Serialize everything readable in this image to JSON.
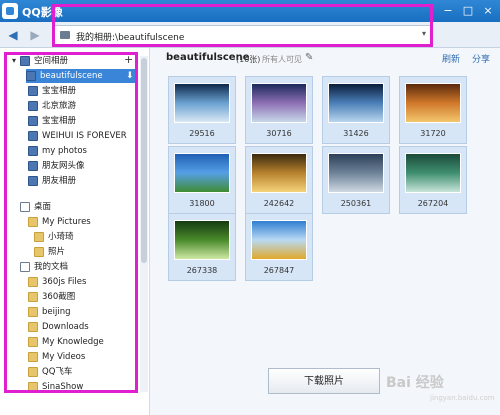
{
  "window": {
    "title": "QQ影像",
    "controls": [
      "−",
      "□",
      "×"
    ]
  },
  "toolbar": {
    "back": "◀",
    "forward": "▶",
    "address": "我的相册:\\beautifulscene",
    "address_dropdown": "▾"
  },
  "sidebar": {
    "items": [
      {
        "label": "空间相册",
        "icon": "album-icon",
        "type": "header"
      },
      {
        "label": "beautifulscene",
        "icon": "album-icon",
        "selected": true
      },
      {
        "label": "宝宝相册",
        "icon": "album-icon"
      },
      {
        "label": "北京旅游",
        "icon": "album-icon"
      },
      {
        "label": "宝宝相册",
        "icon": "album-icon"
      },
      {
        "label": "WEIHUI IS FOREVER",
        "icon": "album-icon"
      },
      {
        "label": "my photos",
        "icon": "album-icon"
      },
      {
        "label": "朋友网头像",
        "icon": "album-icon"
      },
      {
        "label": "朋友相册",
        "icon": "album-icon"
      },
      {
        "label": "桌面",
        "icon": "desktop-icon"
      },
      {
        "label": "My Pictures",
        "icon": "folder-icon"
      },
      {
        "label": "小琦琦",
        "icon": "folder-icon"
      },
      {
        "label": "照片",
        "icon": "folder-icon"
      },
      {
        "label": "我的文档",
        "icon": "documents-icon"
      },
      {
        "label": "360js Files",
        "icon": "folder-icon"
      },
      {
        "label": "360截图",
        "icon": "folder-icon"
      },
      {
        "label": "beijing",
        "icon": "folder-icon"
      },
      {
        "label": "Downloads",
        "icon": "folder-icon"
      },
      {
        "label": "My Knowledge",
        "icon": "folder-icon"
      },
      {
        "label": "My Videos",
        "icon": "folder-icon"
      },
      {
        "label": "QQ飞车",
        "icon": "folder-icon"
      },
      {
        "label": "SinaShow",
        "icon": "folder-icon"
      }
    ],
    "plus": "+",
    "download_mini": "⬇"
  },
  "content": {
    "album_title": "beautifulscene",
    "count": "(10张)",
    "visibility": "所有人可见",
    "edit": "✎",
    "refresh": "刷新",
    "share": "分享",
    "photos": [
      {
        "name": "29516",
        "colors": [
          "#0d2a4a",
          "#6aa0d0",
          "#d8e8f5"
        ]
      },
      {
        "name": "30716",
        "colors": [
          "#1b2a5a",
          "#8e6fb5",
          "#c8d7ea"
        ]
      },
      {
        "name": "31426",
        "colors": [
          "#0a1d3a",
          "#4b7fb8",
          "#b8d5ee"
        ]
      },
      {
        "name": "31720",
        "colors": [
          "#5a2a0d",
          "#d0782a",
          "#f3c66d"
        ]
      },
      {
        "name": "31800",
        "colors": [
          "#1f5fb4",
          "#56a0e6",
          "#3f8c34"
        ]
      },
      {
        "name": "242642",
        "colors": [
          "#3a2a10",
          "#b8822e",
          "#f5d37a"
        ]
      },
      {
        "name": "250361",
        "colors": [
          "#2d3f57",
          "#6e8399",
          "#cfd8e2"
        ]
      },
      {
        "name": "267204",
        "colors": [
          "#1c4a3a",
          "#3f8f70",
          "#c9e4da"
        ]
      },
      {
        "name": "267338",
        "colors": [
          "#163b12",
          "#4a8a2a",
          "#cfe8a4"
        ]
      },
      {
        "name": "267847",
        "colors": [
          "#2f7fd2",
          "#b9d9f3",
          "#e0a82a"
        ]
      }
    ],
    "download_label": "下载照片"
  },
  "watermark": {
    "text": "Bai 经验",
    "sub": "jingyan.baidu.com"
  }
}
